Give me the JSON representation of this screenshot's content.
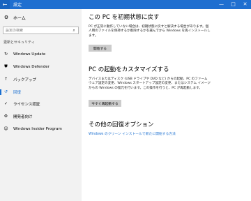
{
  "window": {
    "title": "設定",
    "back_icon": "←",
    "minimize_icon": "—",
    "maximize_icon": "□",
    "close_icon": "✕",
    "titlebar_color": "#1f6fd0"
  },
  "sidebar": {
    "home_label": "ホーム",
    "home_icon": "⚙",
    "search_placeholder": "設定の検索",
    "search_icon": "⌕",
    "section_label": "更新とセキュリティ",
    "items": [
      {
        "label": "Windows Update",
        "icon": "↻"
      },
      {
        "label": "Windows Defender",
        "icon": "⛊"
      },
      {
        "label": "バックアップ",
        "icon": "↑"
      },
      {
        "label": "回復",
        "icon": "↺",
        "selected": true
      },
      {
        "label": "ライセンス認証",
        "icon": "✓"
      },
      {
        "label": "開発者向け",
        "icon": "⚙"
      },
      {
        "label": "Windows Insider Program",
        "icon": "☺"
      }
    ],
    "accent_color": "#1a6fd0"
  },
  "main": {
    "reset": {
      "title": "この PC を初期状態に戻す",
      "desc": "PC が正常に動作していない場合は、初期状態に戻すと解決する場合があります。個人用のファイルを保持するか削除するかを選んでから Windows を再インストールします。",
      "button": "開始する"
    },
    "advanced": {
      "title": "PC の起動をカスタマイズする",
      "desc": "デバイスまたはディスク (USB ドライブや DVD など) からの起動、PC のファームウェア設定の変更、Windows スタートアップ設定の変更、またはシステム イメージからの Windows の復元を行います。この操作を行うと、PC が再起動します。",
      "button": "今すぐ再起動する"
    },
    "more": {
      "title": "その他の回復オプション",
      "link": "Windows のクリーン インストールで新たに開始する方法"
    }
  }
}
